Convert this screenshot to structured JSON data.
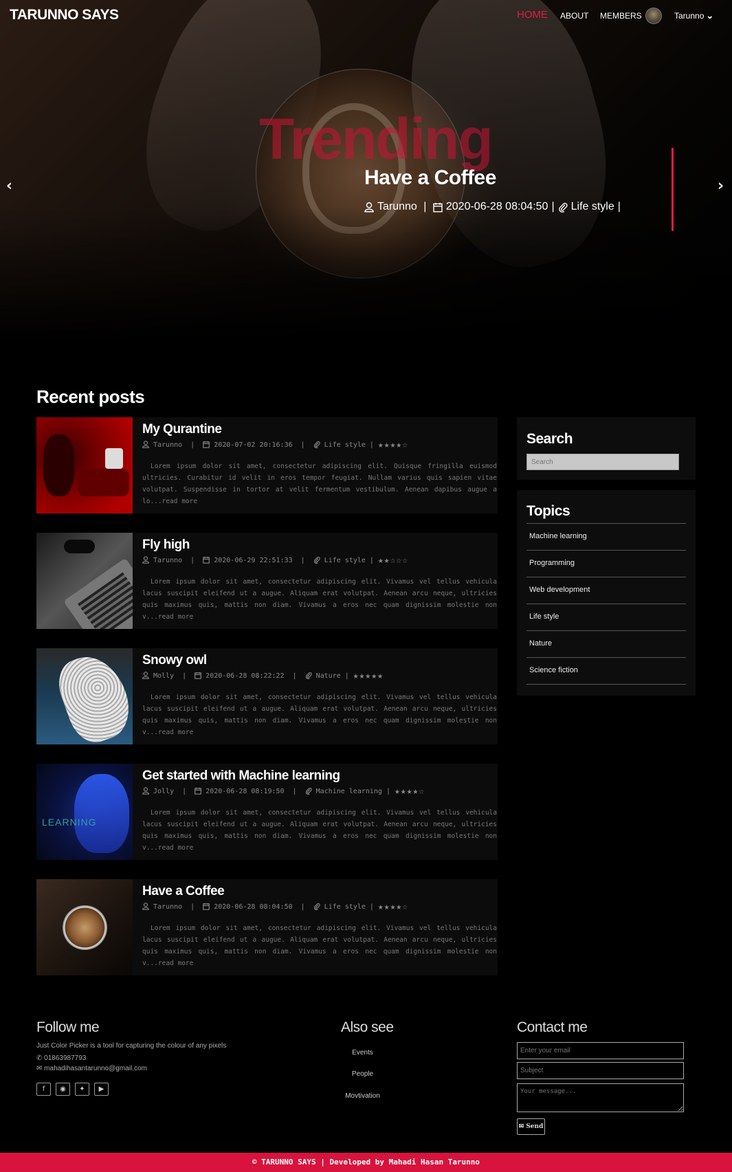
{
  "header": {
    "brand": "TARUNNO SAYS",
    "nav": [
      {
        "label": "HOME",
        "active": true
      },
      {
        "label": "ABOUT"
      },
      {
        "label": "MEMBERS"
      }
    ],
    "user_name": "Tarunno",
    "accent_color": "#e21b45"
  },
  "hero": {
    "overlay_word": "Trending",
    "title": "Have a Coffee",
    "author": "Tarunno",
    "date": "2020-06-28 08:04:50",
    "category": "Life style",
    "prev_icon": "chevron-left",
    "next_icon": "chevron-right"
  },
  "recent": {
    "heading": "Recent posts",
    "posts": [
      {
        "title": "My Qurantine",
        "author": "Tarunno",
        "date": "2020-07-02 20:16:36",
        "category": "Life style",
        "rating": 4,
        "excerpt": "Lorem ipsum dolor sit amet, consectetur adipiscing elit. Quisque fringilla euismod ultricies. Curabitur id velit in eros tempor feugiat. Nullam varius quis sapien vitae volutpat. Suspendisse in tortor at velit fermentum vestibulum. Aenean dapibus augue a lo...read more"
      },
      {
        "title": "Fly high",
        "author": "Tarunno",
        "date": "2020-06-29 22:51:33",
        "category": "Life style",
        "rating": 2,
        "excerpt": "Lorem ipsum dolor sit amet, consectetur adipiscing elit. Vivamus vel tellus vehicula lacus suscipit eleifend ut a augue. Aliquam erat volutpat. Aenean arcu neque, ultricies quis maximus quis, mattis non diam. Vivamus a eros nec quam dignissim molestie non v...read more"
      },
      {
        "title": "Snowy owl",
        "author": "Molly",
        "date": "2020-06-28 08:22:22",
        "category": "Nature",
        "rating": 5,
        "excerpt": "Lorem ipsum dolor sit amet, consectetur adipiscing elit. Vivamus vel tellus vehicula lacus suscipit eleifend ut a augue. Aliquam erat volutpat. Aenean arcu neque, ultricies quis maximus quis, mattis non diam. Vivamus a eros nec quam dignissim molestie non v...read more"
      },
      {
        "title": "Get started with Machine learning",
        "author": "Jolly",
        "date": "2020-06-28 08:19:50",
        "category": "Machine learning",
        "rating": 4,
        "excerpt": "Lorem ipsum dolor sit amet, consectetur adipiscing elit. Vivamus vel tellus vehicula lacus suscipit eleifend ut a augue. Aliquam erat volutpat. Aenean arcu neque, ultricies quis maximus quis, mattis non diam. Vivamus a eros nec quam dignissim molestie non v...read more"
      },
      {
        "title": "Have a Coffee",
        "author": "Tarunno",
        "date": "2020-06-28 08:04:50",
        "category": "Life style",
        "rating": 4,
        "excerpt": "Lorem ipsum dolor sit amet, consectetur adipiscing elit. Vivamus vel tellus vehicula lacus suscipit eleifend ut a augue. Aliquam erat volutpat. Aenean arcu neque, ultricies quis maximus quis, mattis non diam. Vivamus a eros nec quam dignissim molestie non v...read more"
      }
    ],
    "thumb_images": [
      "red-room-woman",
      "laptop-glasses",
      "snowy-owl",
      "ml-blue-face",
      "coffee-latte"
    ]
  },
  "sidebar": {
    "search_heading": "Search",
    "search_placeholder": "Search",
    "topics_heading": "Topics",
    "topics": [
      "Machine learning",
      "Programming",
      "Web development",
      "Life style",
      "Nature",
      "Science fiction"
    ]
  },
  "footer": {
    "follow_heading": "Follow me",
    "follow_text": "Just Color Picker is a tool for capturing the colour of any pixels",
    "phone": "01863987793",
    "email": "mahadihasantarunno@gmail.com",
    "social_icons": [
      "facebook-icon",
      "instagram-icon",
      "twitter-icon",
      "youtube-icon"
    ],
    "also_heading": "Also see",
    "also_links": [
      "Events",
      "People",
      "Movtivation"
    ],
    "contact_heading": "Contact me",
    "email_placeholder": "Enter your email",
    "subject_placeholder": "Subject",
    "message_placeholder": "Your message...",
    "send_label": "Send",
    "copyright": "© TARUNNO SAYS | Developed by Mahadi Hasan Tarunno",
    "copyright_color": "#d8133d"
  }
}
